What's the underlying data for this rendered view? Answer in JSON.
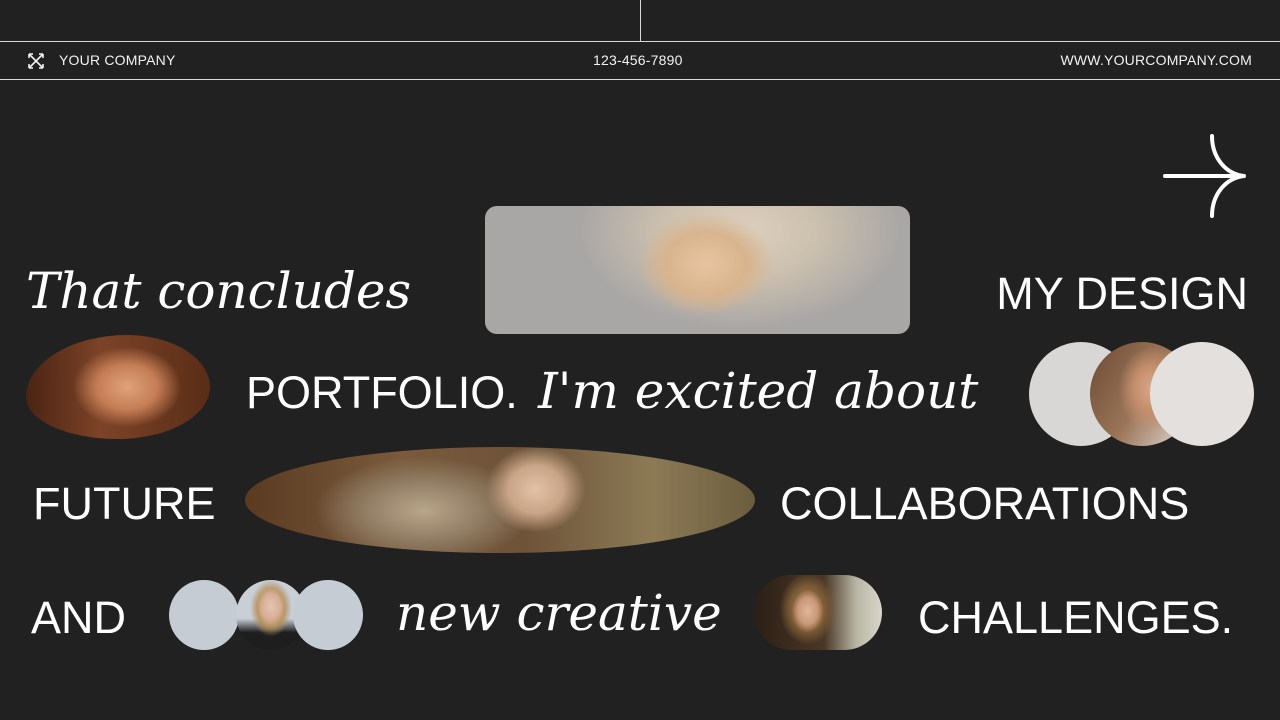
{
  "header": {
    "company": "YOUR COMPANY",
    "phone": "123-456-7890",
    "website": "WWW.YOURCOMPANY.COM",
    "logo_icon": "x-cross-icon"
  },
  "slide": {
    "line1_script": "That concludes",
    "line1_caps": "MY DESIGN",
    "line2_caps": "PORTFOLIO.",
    "line2_script": "I'm excited about",
    "line3_caps_left": "FUTURE",
    "line3_caps_right": "COLLABORATIONS",
    "line4_caps_left": "AND",
    "line4_script": "new creative",
    "line4_caps_right": "CHALLENGES."
  },
  "icons": {
    "next": "arrow-right-icon"
  },
  "colors": {
    "background": "#222122",
    "text": "#ffffff",
    "rule": "#d9d9d9"
  }
}
